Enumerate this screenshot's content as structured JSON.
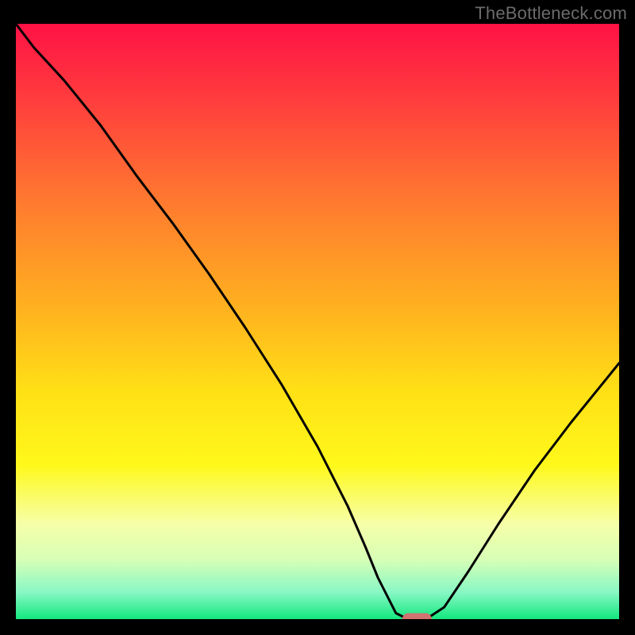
{
  "watermark": "TheBottleneck.com",
  "colors": {
    "gradient_stops": [
      {
        "offset": 0.0,
        "color": "#ff1245"
      },
      {
        "offset": 0.12,
        "color": "#ff3a3e"
      },
      {
        "offset": 0.3,
        "color": "#ff7a2f"
      },
      {
        "offset": 0.48,
        "color": "#ffb21f"
      },
      {
        "offset": 0.62,
        "color": "#ffe116"
      },
      {
        "offset": 0.74,
        "color": "#fff81a"
      },
      {
        "offset": 0.84,
        "color": "#f6ffa8"
      },
      {
        "offset": 0.9,
        "color": "#d7ffb6"
      },
      {
        "offset": 0.955,
        "color": "#88f7c4"
      },
      {
        "offset": 1.0,
        "color": "#13e87f"
      }
    ],
    "curve": "#000000",
    "marker_fill": "#d1736e",
    "marker_stroke": "#d1736e",
    "background": "#000000"
  },
  "chart_data": {
    "type": "line",
    "title": "",
    "xlabel": "",
    "ylabel": "",
    "xlim": [
      0,
      100
    ],
    "ylim": [
      0,
      100
    ],
    "x": [
      0,
      3,
      8,
      14,
      20,
      26,
      32,
      38,
      44,
      50,
      55,
      58,
      60,
      62,
      63,
      65,
      68,
      71,
      75,
      80,
      86,
      92,
      100
    ],
    "series": [
      {
        "name": "bottleneck-curve",
        "values": [
          100,
          96,
          90.5,
          83,
          74.5,
          66.5,
          58,
          49,
          39.5,
          29,
          19,
          12,
          7,
          3,
          1,
          0,
          0,
          2,
          8,
          16,
          25,
          33,
          43
        ]
      }
    ],
    "marker": {
      "x": 66.5,
      "y": 0
    }
  }
}
